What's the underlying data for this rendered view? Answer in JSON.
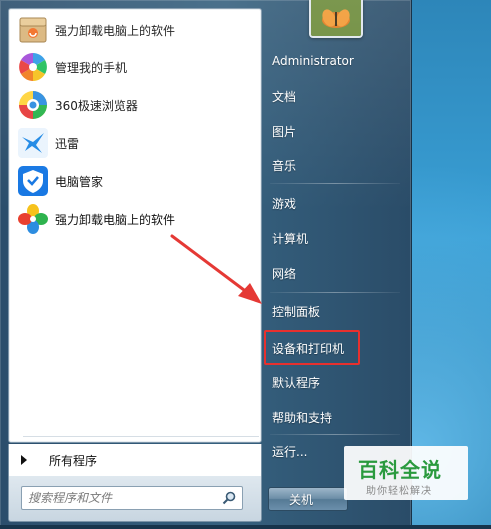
{
  "start_menu": {
    "programs": [
      {
        "label": "强力卸载电脑上的软件",
        "icon": "uninstaller-box-icon"
      },
      {
        "label": "管理我的手机",
        "icon": "phone-manager-icon"
      },
      {
        "label": "360极速浏览器",
        "icon": "browser-360-icon"
      },
      {
        "label": "迅雷",
        "icon": "xunlei-bird-icon"
      },
      {
        "label": "电脑管家",
        "icon": "pc-manager-shield-icon"
      },
      {
        "label": "强力卸载电脑上的软件",
        "icon": "uninstaller-pinwheel-icon"
      }
    ],
    "all_programs_label": "所有程序",
    "search_placeholder": "搜索程序和文件",
    "right_items": {
      "user": "Administrator",
      "documents": "文档",
      "pictures": "图片",
      "music": "音乐",
      "games": "游戏",
      "computer": "计算机",
      "network": "网络",
      "control_panel": "控制面板",
      "devices_printers": "设备和打印机",
      "default_programs": "默认程序",
      "help_support": "帮助和支持",
      "run": "运行..."
    },
    "shutdown_label": "关机"
  },
  "watermark": {
    "title": "百科全说",
    "subtitle": "助你轻松解决"
  },
  "colors": {
    "highlight": "#e8302e",
    "arrow": "#e53935",
    "watermark_green": "#2a9a3e"
  }
}
